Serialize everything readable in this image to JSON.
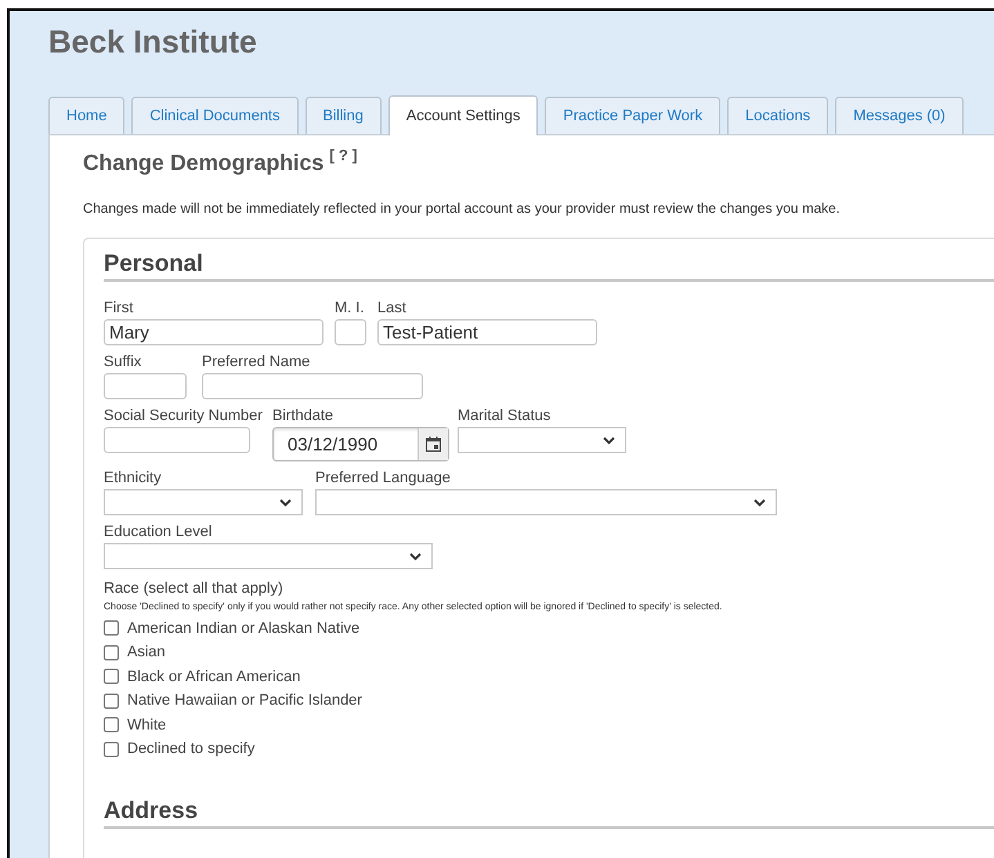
{
  "header": {
    "title": "Beck Institute"
  },
  "tabs": [
    {
      "label": "Home",
      "selected": false
    },
    {
      "label": "Clinical Documents",
      "selected": false
    },
    {
      "label": "Billing",
      "selected": false
    },
    {
      "label": "Account Settings",
      "selected": true
    },
    {
      "label": "Practice Paper Work",
      "selected": false
    },
    {
      "label": "Locations",
      "selected": false
    },
    {
      "label": "Messages (0)",
      "selected": false
    }
  ],
  "page": {
    "heading": "Change Demographics",
    "help": "[ ? ]",
    "notice": "Changes made will not be immediately reflected in your portal account as your provider must review the changes you make."
  },
  "personal": {
    "heading": "Personal",
    "rows": [
      [
        {
          "label": "First",
          "kind": "text",
          "value": "Mary"
        },
        {
          "label": "M. I.",
          "kind": "text"
        },
        {
          "label": "Last",
          "kind": "text",
          "value": "Test-Patient"
        }
      ],
      [
        {
          "label": "Suffix",
          "kind": "text"
        },
        {
          "label": "Preferred Name",
          "kind": "text"
        }
      ],
      [
        {
          "label": "Social Security Number",
          "kind": "text"
        },
        {
          "label": "Birthdate",
          "kind": "date",
          "value": "03/12/1990"
        },
        {
          "label": "Marital Status",
          "kind": "select"
        }
      ],
      [
        {
          "label": "Ethnicity",
          "kind": "select"
        },
        {
          "label": "Preferred Language",
          "kind": "select"
        }
      ],
      [
        {
          "label": "Education Level",
          "kind": "select"
        }
      ]
    ],
    "race": {
      "label": "Race (select all that apply)",
      "note": "Choose 'Declined to specify' only if you would rather not specify race. Any other selected option will be ignored if 'Declined to specify' is selected.",
      "options": [
        {
          "label": "American Indian or Alaskan Native",
          "checked": false
        },
        {
          "label": "Asian",
          "checked": false
        },
        {
          "label": "Black or African American",
          "checked": false
        },
        {
          "label": "Native Hawaiian or Pacific Islander",
          "checked": false
        },
        {
          "label": "White",
          "checked": false
        },
        {
          "label": "Declined to specify",
          "checked": false
        }
      ]
    }
  },
  "address": {
    "heading": "Address"
  }
}
